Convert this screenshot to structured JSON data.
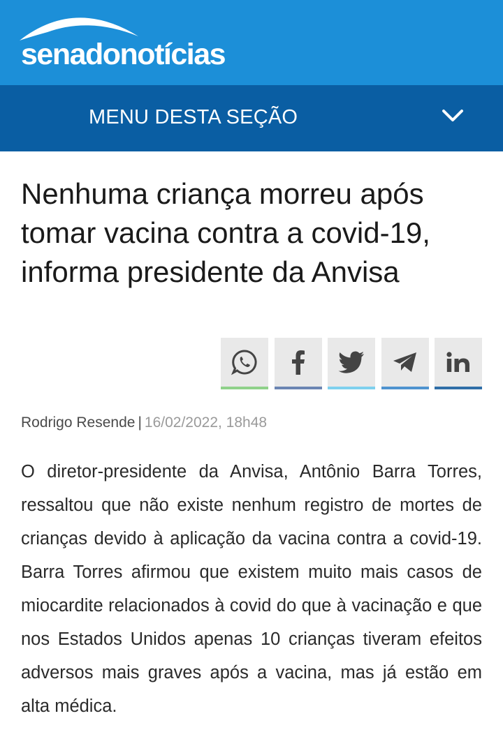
{
  "header": {
    "logo_text": "senadonotícias",
    "brand_color": "#1c8fd8",
    "logo_icon": "arc-logo-icon"
  },
  "menu": {
    "label": "MENU DESTA SEÇÃO",
    "icon": "chevron-down-icon",
    "bg_color": "#0a5ea3"
  },
  "article": {
    "title": "Nenhuma criança morreu após tomar vacina contra a covid-19, informa presidente da Anvisa",
    "author": "Rodrigo Resende",
    "separator": "|",
    "date": "16/02/2022, 18h48",
    "body": "O diretor-presidente da Anvisa, Antônio Barra Torres, ressaltou que não existe nenhum registro de mortes de crianças devido à aplicação da vacina contra a covid-19. Barra Torres afirmou que existem muito mais casos de miocardite relacionados à covid do que à vacinação e que nos Estados Unidos apenas 10 crianças tiveram efeitos adversos mais graves após a vacina, mas já estão em alta médica."
  },
  "share": [
    {
      "icon": "whatsapp-icon",
      "color": "#8fd18a"
    },
    {
      "icon": "facebook-icon",
      "color": "#6b85b3"
    },
    {
      "icon": "twitter-icon",
      "color": "#7ed0ee"
    },
    {
      "icon": "telegram-icon",
      "color": "#4f93cf"
    },
    {
      "icon": "linkedin-icon",
      "color": "#2f6ea7"
    }
  ]
}
